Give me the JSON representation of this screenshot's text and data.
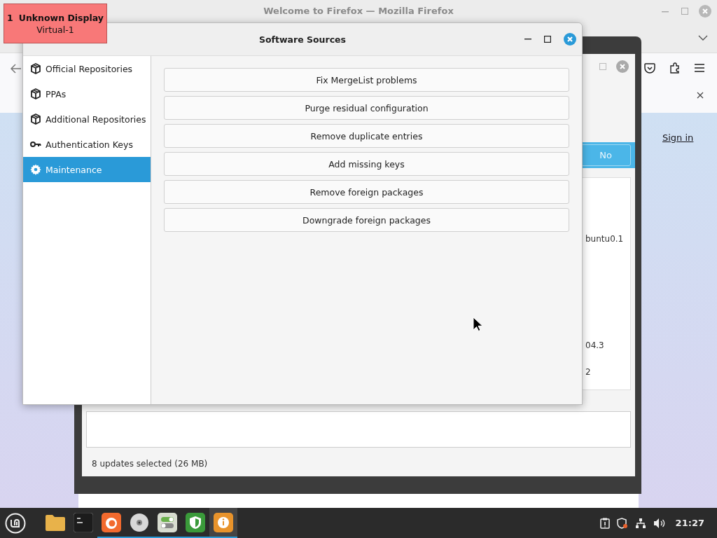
{
  "display_label": {
    "number": "1",
    "name": "Unknown Display",
    "output": "Virtual-1"
  },
  "browser": {
    "title": "Welcome to Firefox — Mozilla Firefox",
    "sign_in": "Sign in"
  },
  "update_manager": {
    "answer_button": "No",
    "versions": [
      "buntu0.1",
      "04.3",
      "2"
    ],
    "status": "8 updates selected (26 MB)"
  },
  "dialog": {
    "title": "Software Sources",
    "sidebar": [
      {
        "label": "Official Repositories",
        "kind": "package",
        "selected": false
      },
      {
        "label": "PPAs",
        "kind": "package",
        "selected": false
      },
      {
        "label": "Additional Repositories",
        "kind": "package",
        "selected": false
      },
      {
        "label": "Authentication Keys",
        "kind": "key",
        "selected": false
      },
      {
        "label": "Maintenance",
        "kind": "gear",
        "selected": true
      }
    ],
    "buttons": [
      "Fix MergeList problems",
      "Purge residual configuration",
      "Remove duplicate entries",
      "Add missing keys",
      "Remove foreign packages",
      "Downgrade foreign packages"
    ]
  },
  "taskbar": {
    "apps": [
      {
        "kind": "files",
        "running": false,
        "selected": false
      },
      {
        "kind": "terminal",
        "running": false,
        "selected": false
      },
      {
        "kind": "firefox",
        "running": true,
        "selected": false
      },
      {
        "kind": "disc",
        "running": true,
        "selected": false
      },
      {
        "kind": "toggles",
        "running": true,
        "selected": false
      },
      {
        "kind": "shield",
        "running": true,
        "selected": false
      },
      {
        "kind": "info",
        "running": true,
        "selected": true
      }
    ],
    "clock": "21:27"
  }
}
